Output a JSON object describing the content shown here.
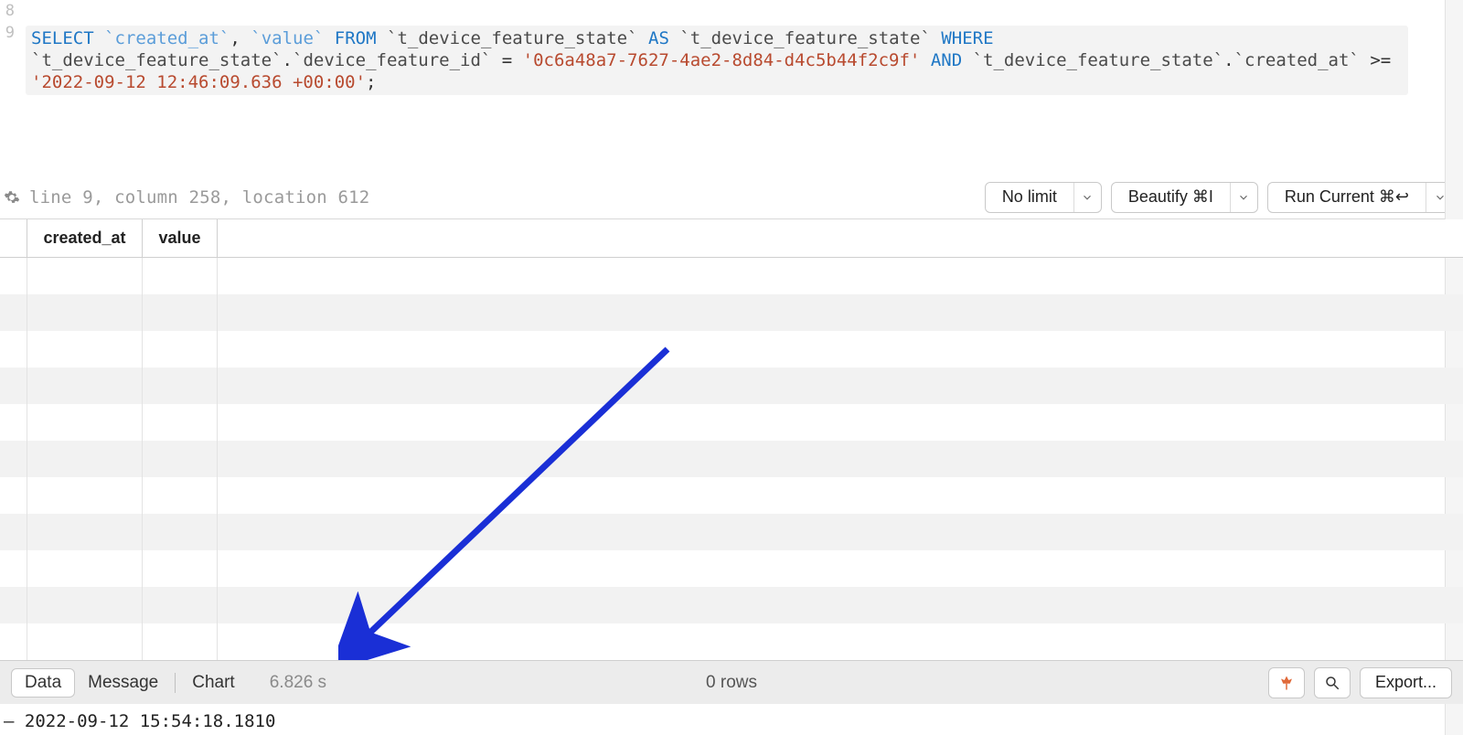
{
  "editor": {
    "line_numbers": [
      "8",
      "9"
    ],
    "sql_tokens": [
      {
        "t": "kw",
        "v": "SELECT"
      },
      {
        "t": "punct",
        "v": " "
      },
      {
        "t": "col",
        "v": "`created_at`"
      },
      {
        "t": "punct",
        "v": ", "
      },
      {
        "t": "col",
        "v": "`value`"
      },
      {
        "t": "punct",
        "v": " "
      },
      {
        "t": "kw",
        "v": "FROM"
      },
      {
        "t": "punct",
        "v": " "
      },
      {
        "t": "id",
        "v": "`t_device_feature_state`"
      },
      {
        "t": "punct",
        "v": " "
      },
      {
        "t": "kw",
        "v": "AS"
      },
      {
        "t": "punct",
        "v": " "
      },
      {
        "t": "id",
        "v": "`t_device_feature_state`"
      },
      {
        "t": "punct",
        "v": " "
      },
      {
        "t": "kw",
        "v": "WHERE"
      },
      {
        "t": "punct",
        "v": " "
      },
      {
        "t": "id",
        "v": "`t_device_feature_state`"
      },
      {
        "t": "punct",
        "v": "."
      },
      {
        "t": "id",
        "v": "`device_feature_id`"
      },
      {
        "t": "punct",
        "v": " = "
      },
      {
        "t": "str",
        "v": "'0c6a48a7-7627-4ae2-8d84-d4c5b44f2c9f'"
      },
      {
        "t": "punct",
        "v": " "
      },
      {
        "t": "kw",
        "v": "AND"
      },
      {
        "t": "punct",
        "v": " "
      },
      {
        "t": "id",
        "v": "`t_device_feature_state`"
      },
      {
        "t": "punct",
        "v": "."
      },
      {
        "t": "id",
        "v": "`created_at`"
      },
      {
        "t": "punct",
        "v": " >= "
      },
      {
        "t": "str",
        "v": "'2022-09-12 12:46:09.636 +00:00'"
      },
      {
        "t": "punct",
        "v": ";"
      }
    ]
  },
  "cursor": {
    "text": "line 9, column 258, location 612"
  },
  "toolbar": {
    "limit_label": "No limit",
    "beautify_label": "Beautify ⌘I",
    "run_label": "Run Current ⌘↩"
  },
  "columns": [
    "created_at",
    "value"
  ],
  "status": {
    "tabs": {
      "data": "Data",
      "message": "Message",
      "chart": "Chart"
    },
    "elapsed": "6.826 s",
    "rows": "0 rows",
    "export": "Export..."
  },
  "log": {
    "line": "– 2022-09-12 15:54:18.1810"
  },
  "empty_rows": 11
}
